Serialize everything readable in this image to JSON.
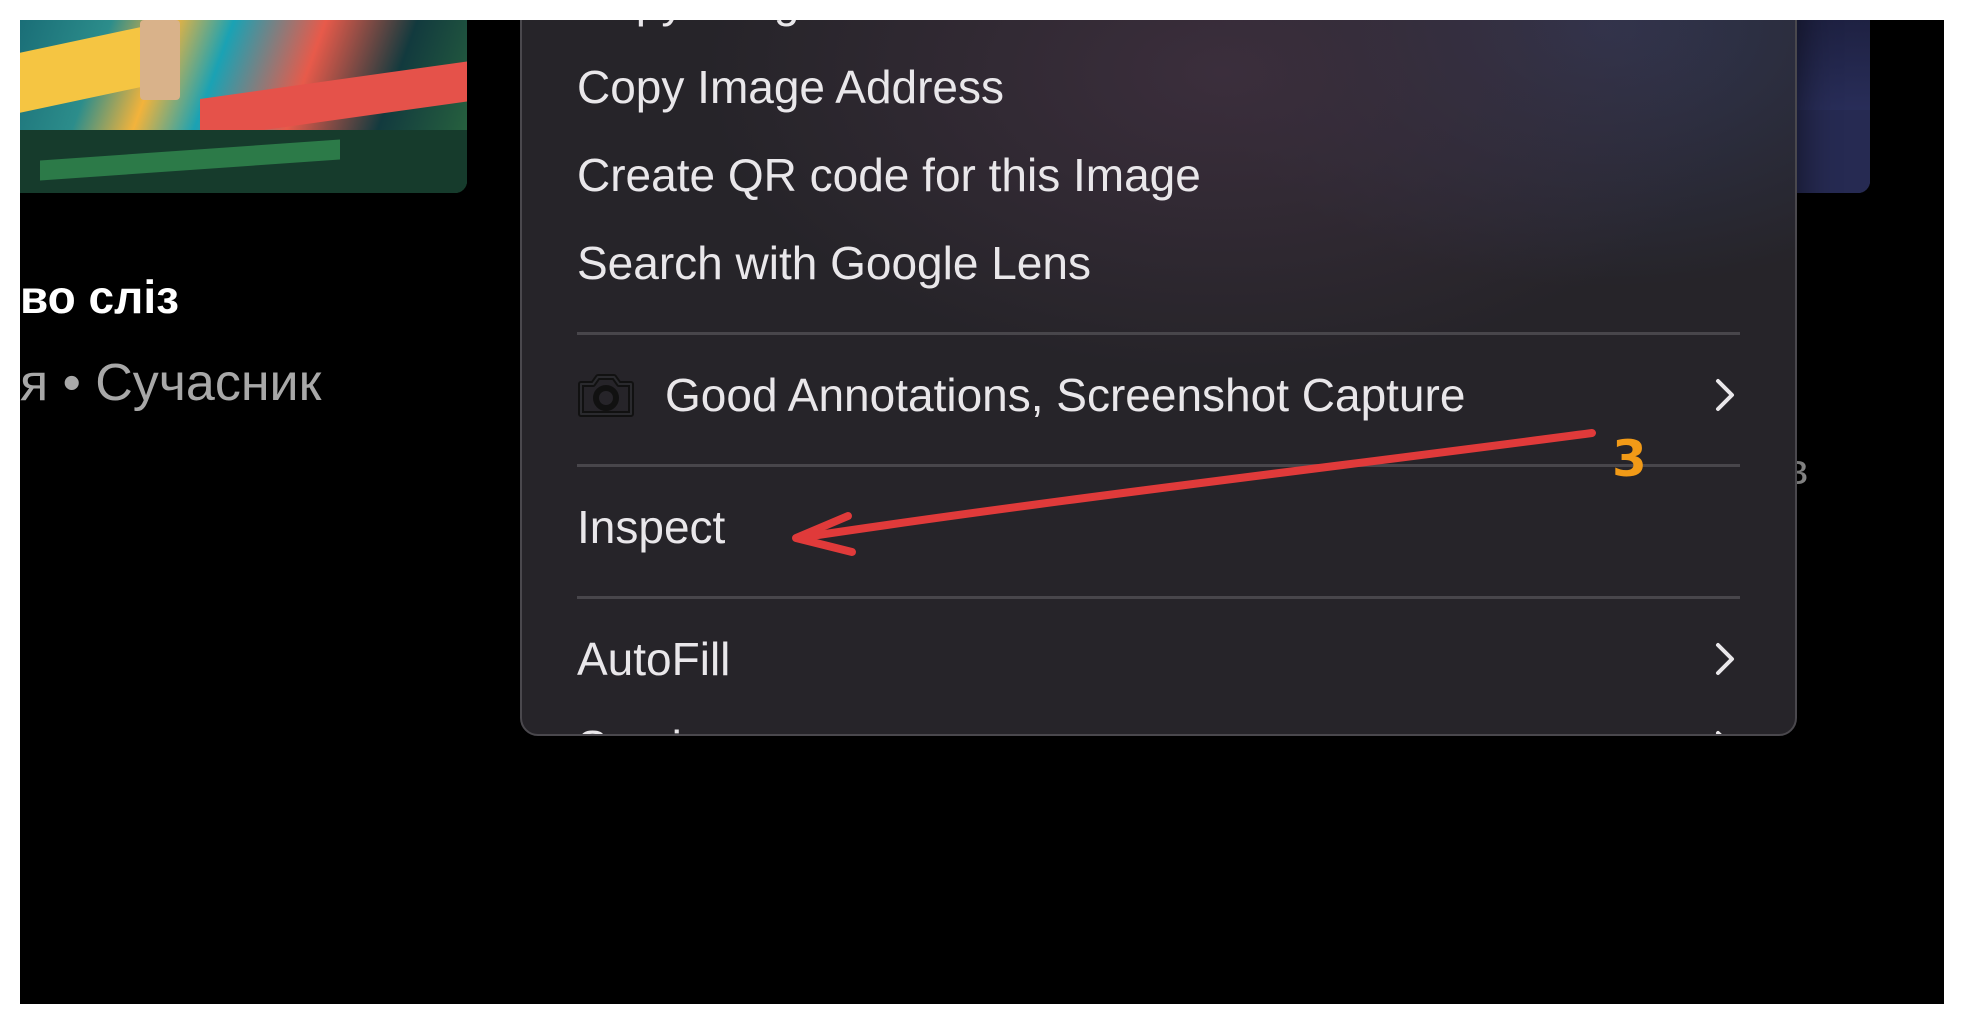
{
  "background_page": {
    "title_fragment": "во сліз",
    "subtitle_fragment": "я • Сучасник",
    "right_fragment": "в"
  },
  "context_menu": {
    "items_top": [
      {
        "label": "Copy Image"
      },
      {
        "label": "Copy Image Address"
      },
      {
        "label": "Create QR code for this Image"
      },
      {
        "label": "Search with Google Lens"
      }
    ],
    "extension_item": {
      "label": "Good Annotations, Screenshot Capture",
      "icon": "camera-icon",
      "has_submenu": true
    },
    "inspect_item": {
      "label": "Inspect"
    },
    "items_bottom": [
      {
        "label": "AutoFill",
        "has_submenu": true
      },
      {
        "label": "Services",
        "has_submenu": true
      }
    ]
  },
  "annotation": {
    "step_number": "3",
    "arrow_color": "#e03a3a",
    "number_color": "#f19a17"
  },
  "colors": {
    "menu_bg": "#262429",
    "menu_text": "#e9e7ea",
    "separator": "#48464b",
    "page_bg": "#000000"
  }
}
